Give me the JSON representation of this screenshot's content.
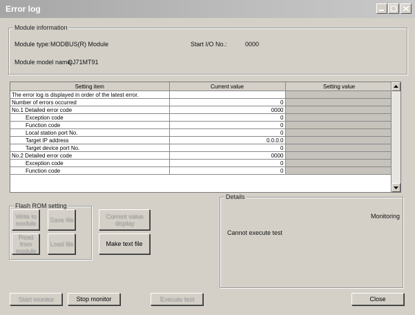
{
  "window": {
    "title": "Error log"
  },
  "module_info": {
    "legend": "Module information",
    "type_label": "Module type:",
    "type_value": "MODBUS(R) Module",
    "start_io_label": "Start I/O No.:",
    "start_io_value": "0000",
    "model_label": "Module model name:",
    "model_value": "QJ71MT91"
  },
  "table": {
    "headers": [
      "Setting item",
      "Current value",
      "Setting value"
    ],
    "rows": [
      {
        "item": "The error log is displayed in order of the latest error.",
        "current": "",
        "indent": false
      },
      {
        "item": "Number of errors occurred",
        "current": "0",
        "indent": false
      },
      {
        "item": "No.1 Detailed error code",
        "current": "0000",
        "indent": false
      },
      {
        "item": "Exception code",
        "current": "0",
        "indent": true
      },
      {
        "item": "Function code",
        "current": "0",
        "indent": true
      },
      {
        "item": "Local station port No.",
        "current": "0",
        "indent": true
      },
      {
        "item": "Target IP address",
        "current": "0.0.0.0",
        "indent": true
      },
      {
        "item": "Target device port No.",
        "current": "0",
        "indent": true
      },
      {
        "item": "No.2 Detailed error code",
        "current": "0000",
        "indent": false
      },
      {
        "item": "Exception code",
        "current": "0",
        "indent": true
      },
      {
        "item": "Function code",
        "current": "0",
        "indent": true
      }
    ]
  },
  "flash_rom": {
    "legend": "Flash ROM setting",
    "write_to_module": "Write to module",
    "save_file": "Save file",
    "read_from_module": "Read from module",
    "load_file": "Load file",
    "current_value_display": "Current value display",
    "make_text_file": "Make text file"
  },
  "details": {
    "legend": "Details",
    "status": "Monitoring",
    "message": "Cannot execute test"
  },
  "bottom": {
    "start_monitor": "Start monitor",
    "stop_monitor": "Stop monitor",
    "execute_test": "Execute test",
    "close": "Close"
  }
}
